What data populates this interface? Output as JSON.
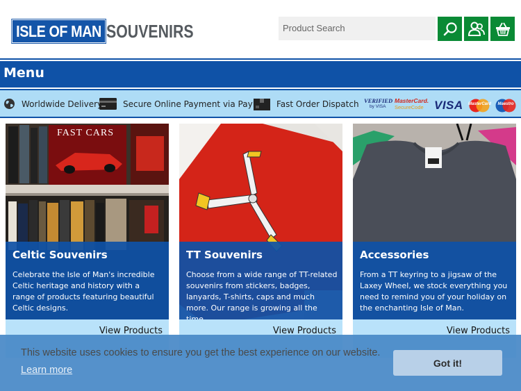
{
  "header": {
    "logo_main": "ISLE OF MAN",
    "logo_sub": "SOUVENIRS",
    "search_placeholder": "Product Search",
    "icons": [
      "search-icon",
      "account-icon",
      "basket-icon"
    ],
    "accent": "#0a8a35"
  },
  "menu": {
    "label": "Menu",
    "color": "#0f52a7"
  },
  "strip": {
    "items": [
      {
        "icon": "globe-icon",
        "label": "Worldwide Delivery"
      },
      {
        "icon": "card-icon",
        "label": "Secure Online Payment via PayPal"
      },
      {
        "icon": "dispatch-icon",
        "label": "Fast Order Dispatch"
      }
    ],
    "payment_logos": {
      "verified_line1": "VERIFIED",
      "verified_line2": "by VISA",
      "securecode_line1": "MasterCard.",
      "securecode_line2": "SecureCode",
      "visa": "VISA",
      "mastercard": "MasterCard",
      "maestro": "Maestro"
    }
  },
  "cards": [
    {
      "title": "Celtic Souvenirs",
      "desc": "Celebrate the Isle of Man's incredible Celtic heritage and history with a range of products featuring beautiful Celtic designs.",
      "link": "View Products",
      "image_text": "FAST CARS"
    },
    {
      "title": "TT Souvenirs",
      "desc": "Choose from a wide range of TT-related souvenirs from stickers, badges, lanyards, T-shirts, caps and much more. Our range is growing all the time.",
      "link": "View Products"
    },
    {
      "title": "Accessories",
      "desc": "From a TT keyring to a jigsaw of the Laxey Wheel, we stock everything you need to remind you of your holiday on the enchanting Isle of Man.",
      "link": "View Products"
    }
  ],
  "cookie": {
    "message": "This website uses cookies to ensure you get the best experience on our website.",
    "learn_more": "Learn more",
    "button": "Got it!"
  }
}
